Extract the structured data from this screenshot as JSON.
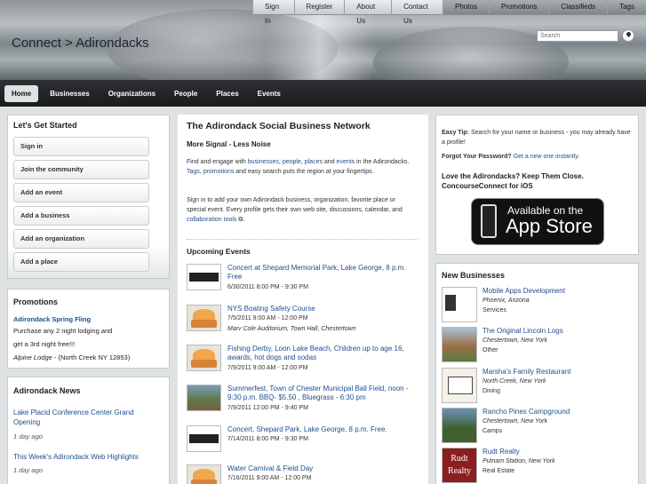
{
  "topnav": {
    "items": [
      "Sign In",
      "Register",
      "About Us",
      "Contact Us",
      "Photos",
      "Promotions",
      "Classifieds",
      "Tags"
    ]
  },
  "header": {
    "site_title": "Connect > Adirondacks",
    "search_placeholder": "Search"
  },
  "mainnav": {
    "items": [
      "Home",
      "Businesses",
      "Organizations",
      "People",
      "Places",
      "Events"
    ],
    "active": "Home"
  },
  "get_started": {
    "title": "Let's Get Started",
    "buttons": [
      "Sign in",
      "Join the community",
      "Add an event",
      "Add a business",
      "Add an organization",
      "Add a place"
    ]
  },
  "promotions": {
    "title": "Promotions",
    "link": "Adirondack Spring Fling",
    "line1": "Purchase any 2 night lodging and",
    "line2": "get a 3rd night free!!!",
    "location_name": "Alpine Lodge",
    "location_rest": " - (North Creek NY 12853)"
  },
  "news": {
    "title": "Adirondack News",
    "items": [
      {
        "title": "Lake Placid Conference Center Grand Opening",
        "date": "1 day ago"
      },
      {
        "title": "This Week's Adirondack Web Highlights",
        "date": "1 day ago"
      }
    ]
  },
  "center": {
    "heading": "The Adirondack Social Business Network",
    "subheading": "More Signal - Less Noise",
    "p1": {
      "t1": "Find and engage with ",
      "l1": "businesses",
      "t2": ", ",
      "l2": "people",
      "t3": ", ",
      "l3": "places",
      "t4": " and ",
      "l4": "events",
      "t5": " in the Adirondacks. ",
      "l5": "Tags",
      "t6": ", ",
      "l6": "promotions",
      "t7": " and easy search puts the region at your fingertips."
    },
    "p2": {
      "t1": "Sign in to add your own Adirondack business, organization, favorite place or special event. Every profile gets their own web site, discussions, calendar, and ",
      "l1": "collaboration tools",
      "t2": "."
    },
    "upcoming_title": "Upcoming Events",
    "events": [
      {
        "title": "Concert at Shepard Memorial Park, Lake George, 8 p.m. Free",
        "when": "6/30/2011 8:00 PM - 9:30 PM",
        "where": ""
      },
      {
        "title": "NYS Boating Safety Course",
        "when": "7/5/2011 9:00 AM - 12:00 PM",
        "where": "Marv Cole Auditorium, Town Hall, Chestertown"
      },
      {
        "title": "Fishing Derby, Loon Lake Beach, Children up to age 16, awards, hot dogs and sodas",
        "when": "7/9/2011 9:00 AM - 12:00 PM",
        "where": ""
      },
      {
        "title": "Summerfest, Town of Chester Municipal Ball Field, noon - 9:30 p.m. BBQ- $5.50 , Bluegrass - 6:30 pm",
        "when": "7/9/2011 12:00 PM - 9:40 PM",
        "where": ""
      },
      {
        "title": "Concert, Shepard Park, Lake George, 8 p.m. Free.",
        "when": "7/14/2011 8:00 PM - 9:30 PM",
        "where": ""
      },
      {
        "title": "Water Carnival & Field Day",
        "when": "7/16/2011 9:00 AM - 12:00 PM",
        "where": ""
      }
    ]
  },
  "right_top": {
    "tip_label": "Easy Tip:",
    "tip_text": " Search for your name or business - you may already have a profile!",
    "forgot_label": "Forgot Your Password?",
    "forgot_link": "Get a new one instantly.",
    "love": "Love the Adirondacks? Keep Them Close. ConcourseConnect for iOS",
    "appstore_line1": "Available on the",
    "appstore_line2": "App Store"
  },
  "new_businesses": {
    "title": "New Businesses",
    "items": [
      {
        "name": "Mobile Apps Development",
        "location": "Phoenix, Arizona",
        "category": "Services"
      },
      {
        "name": "The Original Lincoln Logs",
        "location": "Chestertown, New York",
        "category": "Other"
      },
      {
        "name": "Marsha's Family Restaurant",
        "location": "North Creek, New York",
        "category": "Dining"
      },
      {
        "name": "Rancho Pines Campground",
        "location": "Chestertown, New York",
        "category": "Camps"
      },
      {
        "name": "Rudt Realty",
        "location": "Putnam Station, New York",
        "category": "Real Estate"
      }
    ],
    "rudt_logo_text": "Rudt Realty"
  }
}
